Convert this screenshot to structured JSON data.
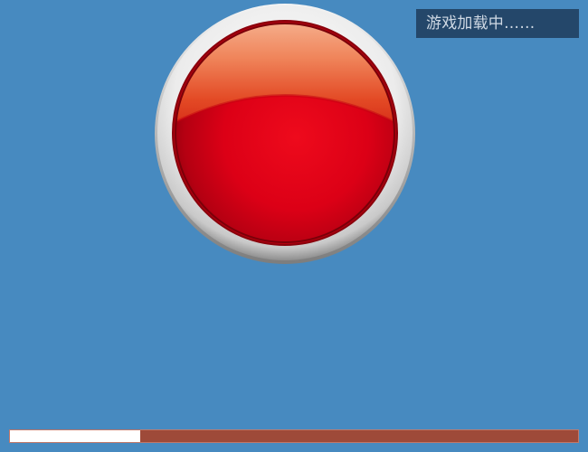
{
  "status": {
    "loading_text": "游戏加载中……"
  },
  "button": {
    "icon": "red-round-button-icon",
    "color": "#e0001a"
  },
  "loading": {
    "progress": 0.23,
    "track_color": "#9e4a39",
    "fill_color": "#ffffff"
  },
  "colors": {
    "background": "#478ac0",
    "badge": "#24476a"
  }
}
